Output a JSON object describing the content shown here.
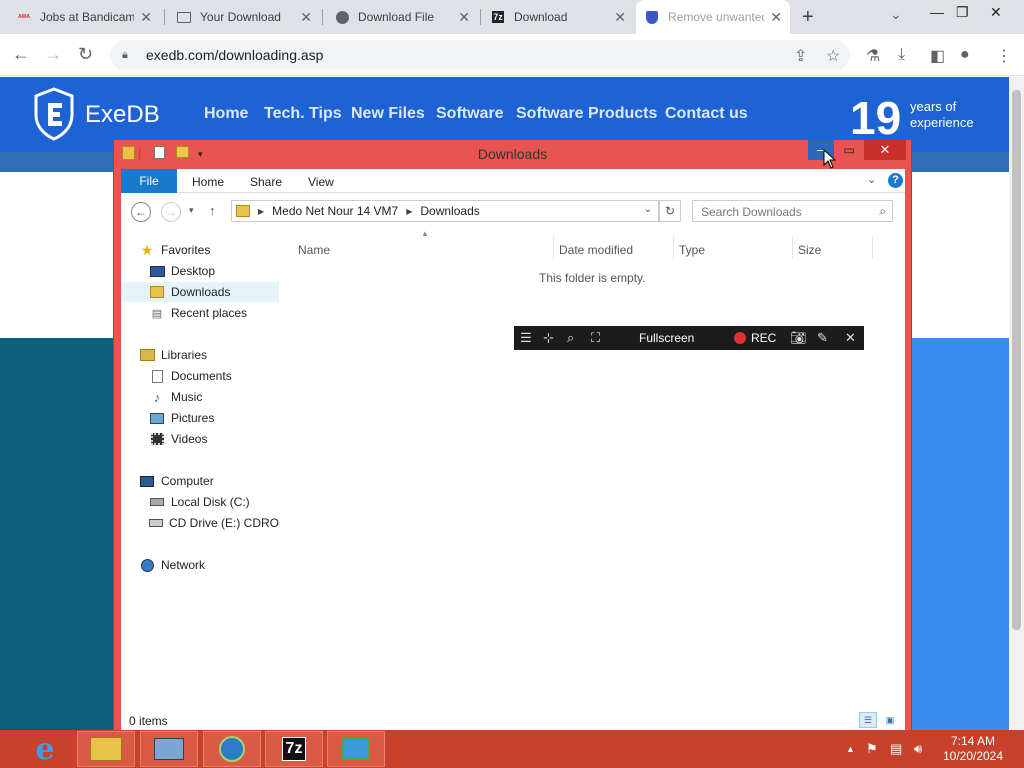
{
  "browser": {
    "tabs": [
      {
        "title": "Jobs at Bandicam",
        "icon": "bandicam-icon",
        "active": false
      },
      {
        "title": "Your Download",
        "icon": "page-icon",
        "active": false
      },
      {
        "title": "Download File",
        "icon": "globe-icon",
        "active": false
      },
      {
        "title": "Download",
        "icon": "7zip-icon",
        "active": false
      },
      {
        "title": "Remove unwanted",
        "icon": "shield-icon",
        "active": true
      }
    ],
    "url": "exedb.com/downloading.asp"
  },
  "site": {
    "logo": "ExeDB",
    "nav": [
      "Home",
      "Tech. Tips",
      "New Files",
      "Software",
      "Software Products",
      "Contact us"
    ],
    "years_num": "19",
    "years_line1": "years of",
    "years_line2": "experience"
  },
  "explorer": {
    "title": "Downloads",
    "ribbon_tabs": [
      "File",
      "Home",
      "Share",
      "View"
    ],
    "breadcrumb": [
      "Medo Net Nour 14 VM7",
      "Downloads"
    ],
    "search_placeholder": "Search Downloads",
    "nav_groups": [
      {
        "label": "Favorites",
        "icon": "star-icon",
        "items": [
          {
            "label": "Desktop",
            "icon": "desktop-icon"
          },
          {
            "label": "Downloads",
            "icon": "downloads-folder-icon",
            "selected": true
          },
          {
            "label": "Recent places",
            "icon": "recent-places-icon"
          }
        ]
      },
      {
        "label": "Libraries",
        "icon": "libraries-icon",
        "items": [
          {
            "label": "Documents",
            "icon": "documents-icon"
          },
          {
            "label": "Music",
            "icon": "music-icon"
          },
          {
            "label": "Pictures",
            "icon": "pictures-icon"
          },
          {
            "label": "Videos",
            "icon": "videos-icon"
          }
        ]
      },
      {
        "label": "Computer",
        "icon": "computer-icon",
        "items": [
          {
            "label": "Local Disk (C:)",
            "icon": "local-disk-icon"
          },
          {
            "label": "CD Drive (E:) CDROM",
            "icon": "cd-drive-icon"
          }
        ]
      },
      {
        "label": "Network",
        "icon": "network-icon",
        "items": []
      }
    ],
    "columns": [
      "Name",
      "Date modified",
      "Type",
      "Size"
    ],
    "empty_message": "This folder is empty.",
    "status_count": "0 items"
  },
  "recorder": {
    "fullscreen_label": "Fullscreen",
    "rec_label": "REC"
  },
  "taskbar": {
    "apps": [
      "internet-explorer-icon",
      "file-explorer-icon",
      "server-manager-icon",
      "globe-app-icon",
      "7zip-icon",
      "remote-desktop-icon"
    ],
    "time": "7:14 AM",
    "date": "10/20/2024"
  }
}
